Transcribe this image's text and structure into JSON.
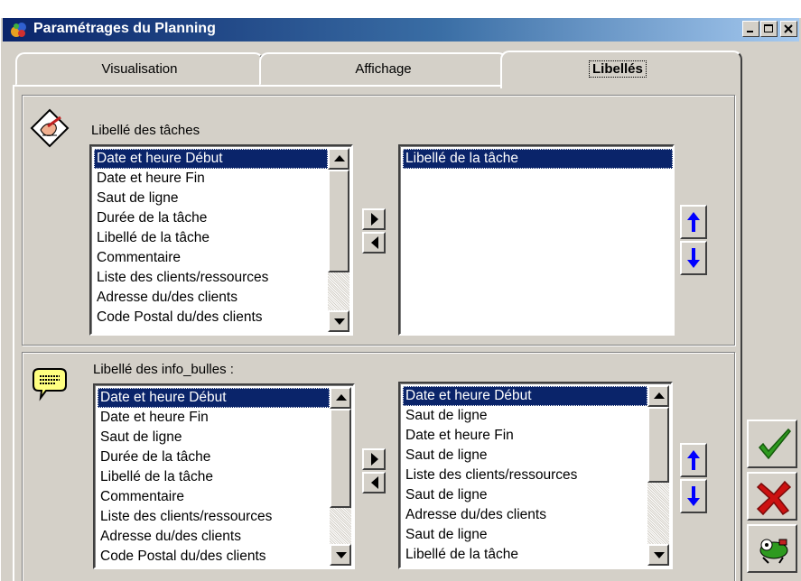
{
  "window": {
    "title": "Paramétrages du Planning",
    "controls": [
      "minimize",
      "maximize",
      "close"
    ]
  },
  "tabs": [
    {
      "label": "Visualisation",
      "active": false
    },
    {
      "label": "Affichage",
      "active": false
    },
    {
      "label": "Libellés",
      "active": true
    }
  ],
  "tasks": {
    "heading": "Libellé des tâches",
    "available": [
      "Date et heure Début",
      "Date et heure Fin",
      "Saut de ligne",
      "Durée de la tâche",
      "Libellé de la tâche",
      "Commentaire",
      "Liste des clients/ressources",
      "Adresse du/des clients",
      "Code Postal du/des clients"
    ],
    "available_selected": "Date et heure Début",
    "chosen": [
      "Libellé de la tâche"
    ],
    "chosen_selected": "Libellé de la tâche"
  },
  "tooltips": {
    "heading": "Libellé des info_bulles :",
    "available": [
      "Date et heure Début",
      "Date et heure Fin",
      "Saut de ligne",
      "Durée de la tâche",
      "Libellé de la tâche",
      "Commentaire",
      "Liste des clients/ressources",
      "Adresse du/des clients",
      "Code Postal du/des clients"
    ],
    "available_selected": "Date et heure Début",
    "chosen": [
      "Date et heure Début",
      "Saut de ligne",
      "Date et heure Fin",
      "Saut de ligne",
      "Liste des clients/ressources",
      "Saut de ligne",
      "Adresse du/des clients",
      "Saut de ligne",
      "Libellé de la tâche"
    ],
    "chosen_selected": "Date et heure Début"
  },
  "buttons": {
    "add": "right-arrow-icon",
    "remove": "left-arrow-icon",
    "move_up": "blue-up-arrow-icon",
    "move_down": "blue-down-arrow-icon",
    "validate": "green-check-icon",
    "cancel": "red-x-icon",
    "help": "help-character-icon"
  },
  "colors": {
    "title_bar_start": "#0a246a",
    "title_bar_end": "#a6caf0",
    "selection": "#0a246a",
    "arrow_blue": "#0000ff",
    "check_green": "#2e9a1f",
    "cancel_red": "#cc1111"
  }
}
